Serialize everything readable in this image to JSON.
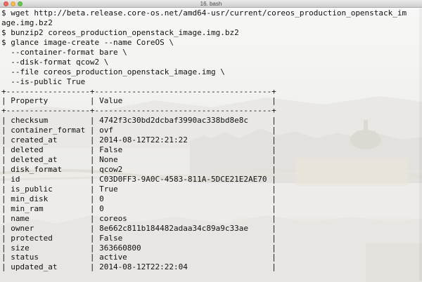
{
  "window": {
    "title": "16. bash"
  },
  "terminal": {
    "lines": [
      "$ wget http://beta.release.core-os.net/amd64-usr/current/coreos_production_openstack_im",
      "age.img.bz2",
      "$ bunzip2 coreos_production_openstack_image.img.bz2",
      "$ glance image-create --name CoreOS \\",
      "  --container-format bare \\",
      "  --disk-format qcow2 \\",
      "  --file coreos_production_openstack_image.img \\",
      "  --is-public True",
      "+------------------+--------------------------------------+",
      "| Property         | Value                                |",
      "+------------------+--------------------------------------+",
      "| checksum         | 4742f3c30bd2dcbaf3990ac338bd8e8c     |",
      "| container_format | ovf                                  |",
      "| created_at       | 2014-08-12T22:21:22                  |",
      "| deleted          | False                                |",
      "| deleted_at       | None                                 |",
      "| disk_format      | qcow2                                |",
      "| id               | C03D0FF3-9A0C-4583-811A-5DCE21E2AE70 |",
      "| is_public        | True                                 |",
      "| min_disk         | 0                                    |",
      "| min_ram          | 0                                    |",
      "| name             | coreos                               |",
      "| owner            | 8e662c811b184482adaa34c89a9c33ae     |",
      "| protected        | False                                |",
      "| size             | 363660800                            |",
      "| status           | active                               |",
      "| updated_at       | 2014-08-12T22:22:04                  |"
    ]
  }
}
